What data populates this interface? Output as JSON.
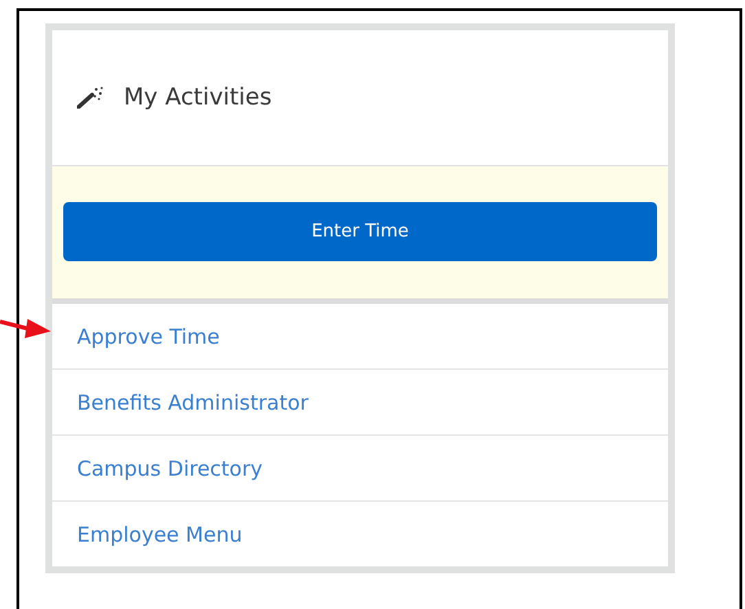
{
  "panel": {
    "title": "My Activities"
  },
  "primary_action": {
    "label": "Enter Time"
  },
  "links": [
    {
      "label": "Approve Time"
    },
    {
      "label": "Benefits Administrator"
    },
    {
      "label": "Campus Directory"
    },
    {
      "label": "Employee Menu"
    }
  ]
}
